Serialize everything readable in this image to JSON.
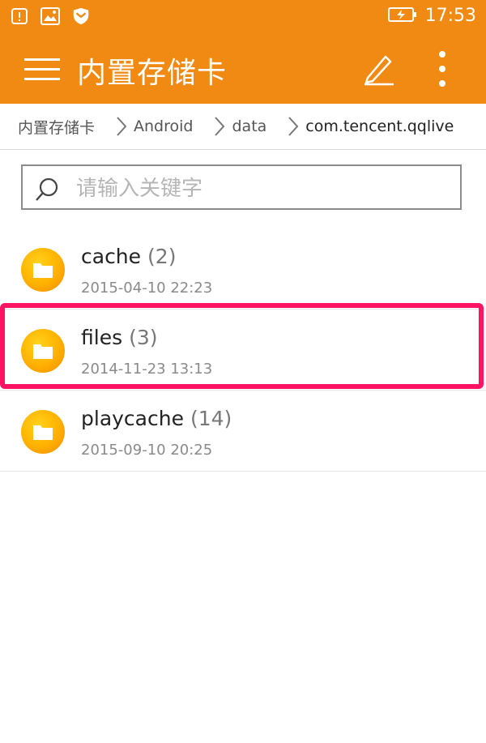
{
  "statusbar": {
    "icons_left": [
      "alert-icon",
      "image-icon",
      "shield-icon"
    ],
    "battery_icon": "battery-charging-icon",
    "time": "17:53"
  },
  "appbar": {
    "title": "内置存储卡",
    "menu_icon": "hamburger-menu-icon",
    "edit_icon": "pencil-icon",
    "more_icon": "more-vertical-icon"
  },
  "breadcrumb": [
    {
      "label": "内置存储卡"
    },
    {
      "label": "Android"
    },
    {
      "label": "data"
    },
    {
      "label": "com.tencent.qqlive"
    }
  ],
  "search": {
    "placeholder": "请输入关键字",
    "value": ""
  },
  "files": [
    {
      "name": "cache",
      "count": "(2)",
      "date": "2015-04-10 22:23"
    },
    {
      "name": "files",
      "count": "(3)",
      "date": "2014-11-23 13:13"
    },
    {
      "name": "playcache",
      "count": "(14)",
      "date": "2015-09-10 20:25"
    }
  ],
  "colors": {
    "accent": "#f18a12",
    "highlight": "#ff1464",
    "folder": "#ffb000"
  },
  "highlighted_item": "files"
}
